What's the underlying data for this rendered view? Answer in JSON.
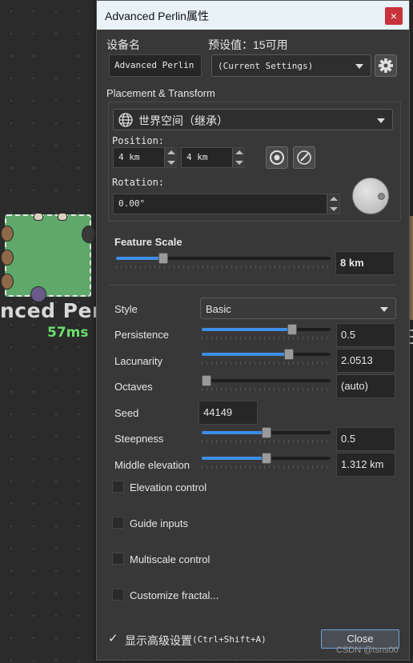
{
  "background": {
    "node_label": "nced Perl",
    "node_time": "57ms"
  },
  "dialog": {
    "title": "Advanced Perlin属性",
    "close_x": "×",
    "device_name_label": "设备名",
    "device_name_value": "Advanced Perlin",
    "preset_label": "预设值：15可用",
    "preset_value": "(Current Settings)",
    "placement_section": "Placement & Transform",
    "space_value": "世界空间（继承）",
    "position_label": "Position:",
    "position_x": "4 km",
    "position_y": "4 km",
    "rotation_label": "Rotation:",
    "rotation_value": "0.00°",
    "feature_scale_label": "Feature Scale",
    "feature_scale_value": "8 km",
    "style_label": "Style",
    "style_value": "Basic",
    "params": [
      {
        "label": "Persistence",
        "value": "0.5",
        "level": 0.7
      },
      {
        "label": "Lacunarity",
        "value": "2.0513",
        "level": 0.68
      },
      {
        "label": "Octaves",
        "value": "(auto)",
        "level": 0.0
      },
      {
        "label": "Seed",
        "value": "44149"
      },
      {
        "label": "Steepness",
        "value": "0.5",
        "level": 0.5
      },
      {
        "label": "Middle elevation",
        "value": "1.312 km",
        "level": 0.5
      }
    ],
    "feature_scale_level": 0.22,
    "checkboxes": [
      "Elevation control",
      "Guide inputs",
      "Multiscale control",
      "Customize fractal..."
    ],
    "show_advanced_label": "显示高级设置",
    "show_advanced_shortcut": "(Ctrl+Shift+A)",
    "show_advanced_check": "✓",
    "close_button": "Close",
    "watermark": "CSDN @tsns00"
  },
  "colors": {
    "accent": "#3e8ee6",
    "titlebar": "#e8f2f7",
    "close_red": "#c8323a",
    "node_green": "#5fa96b",
    "time_green": "#6dde6d"
  }
}
